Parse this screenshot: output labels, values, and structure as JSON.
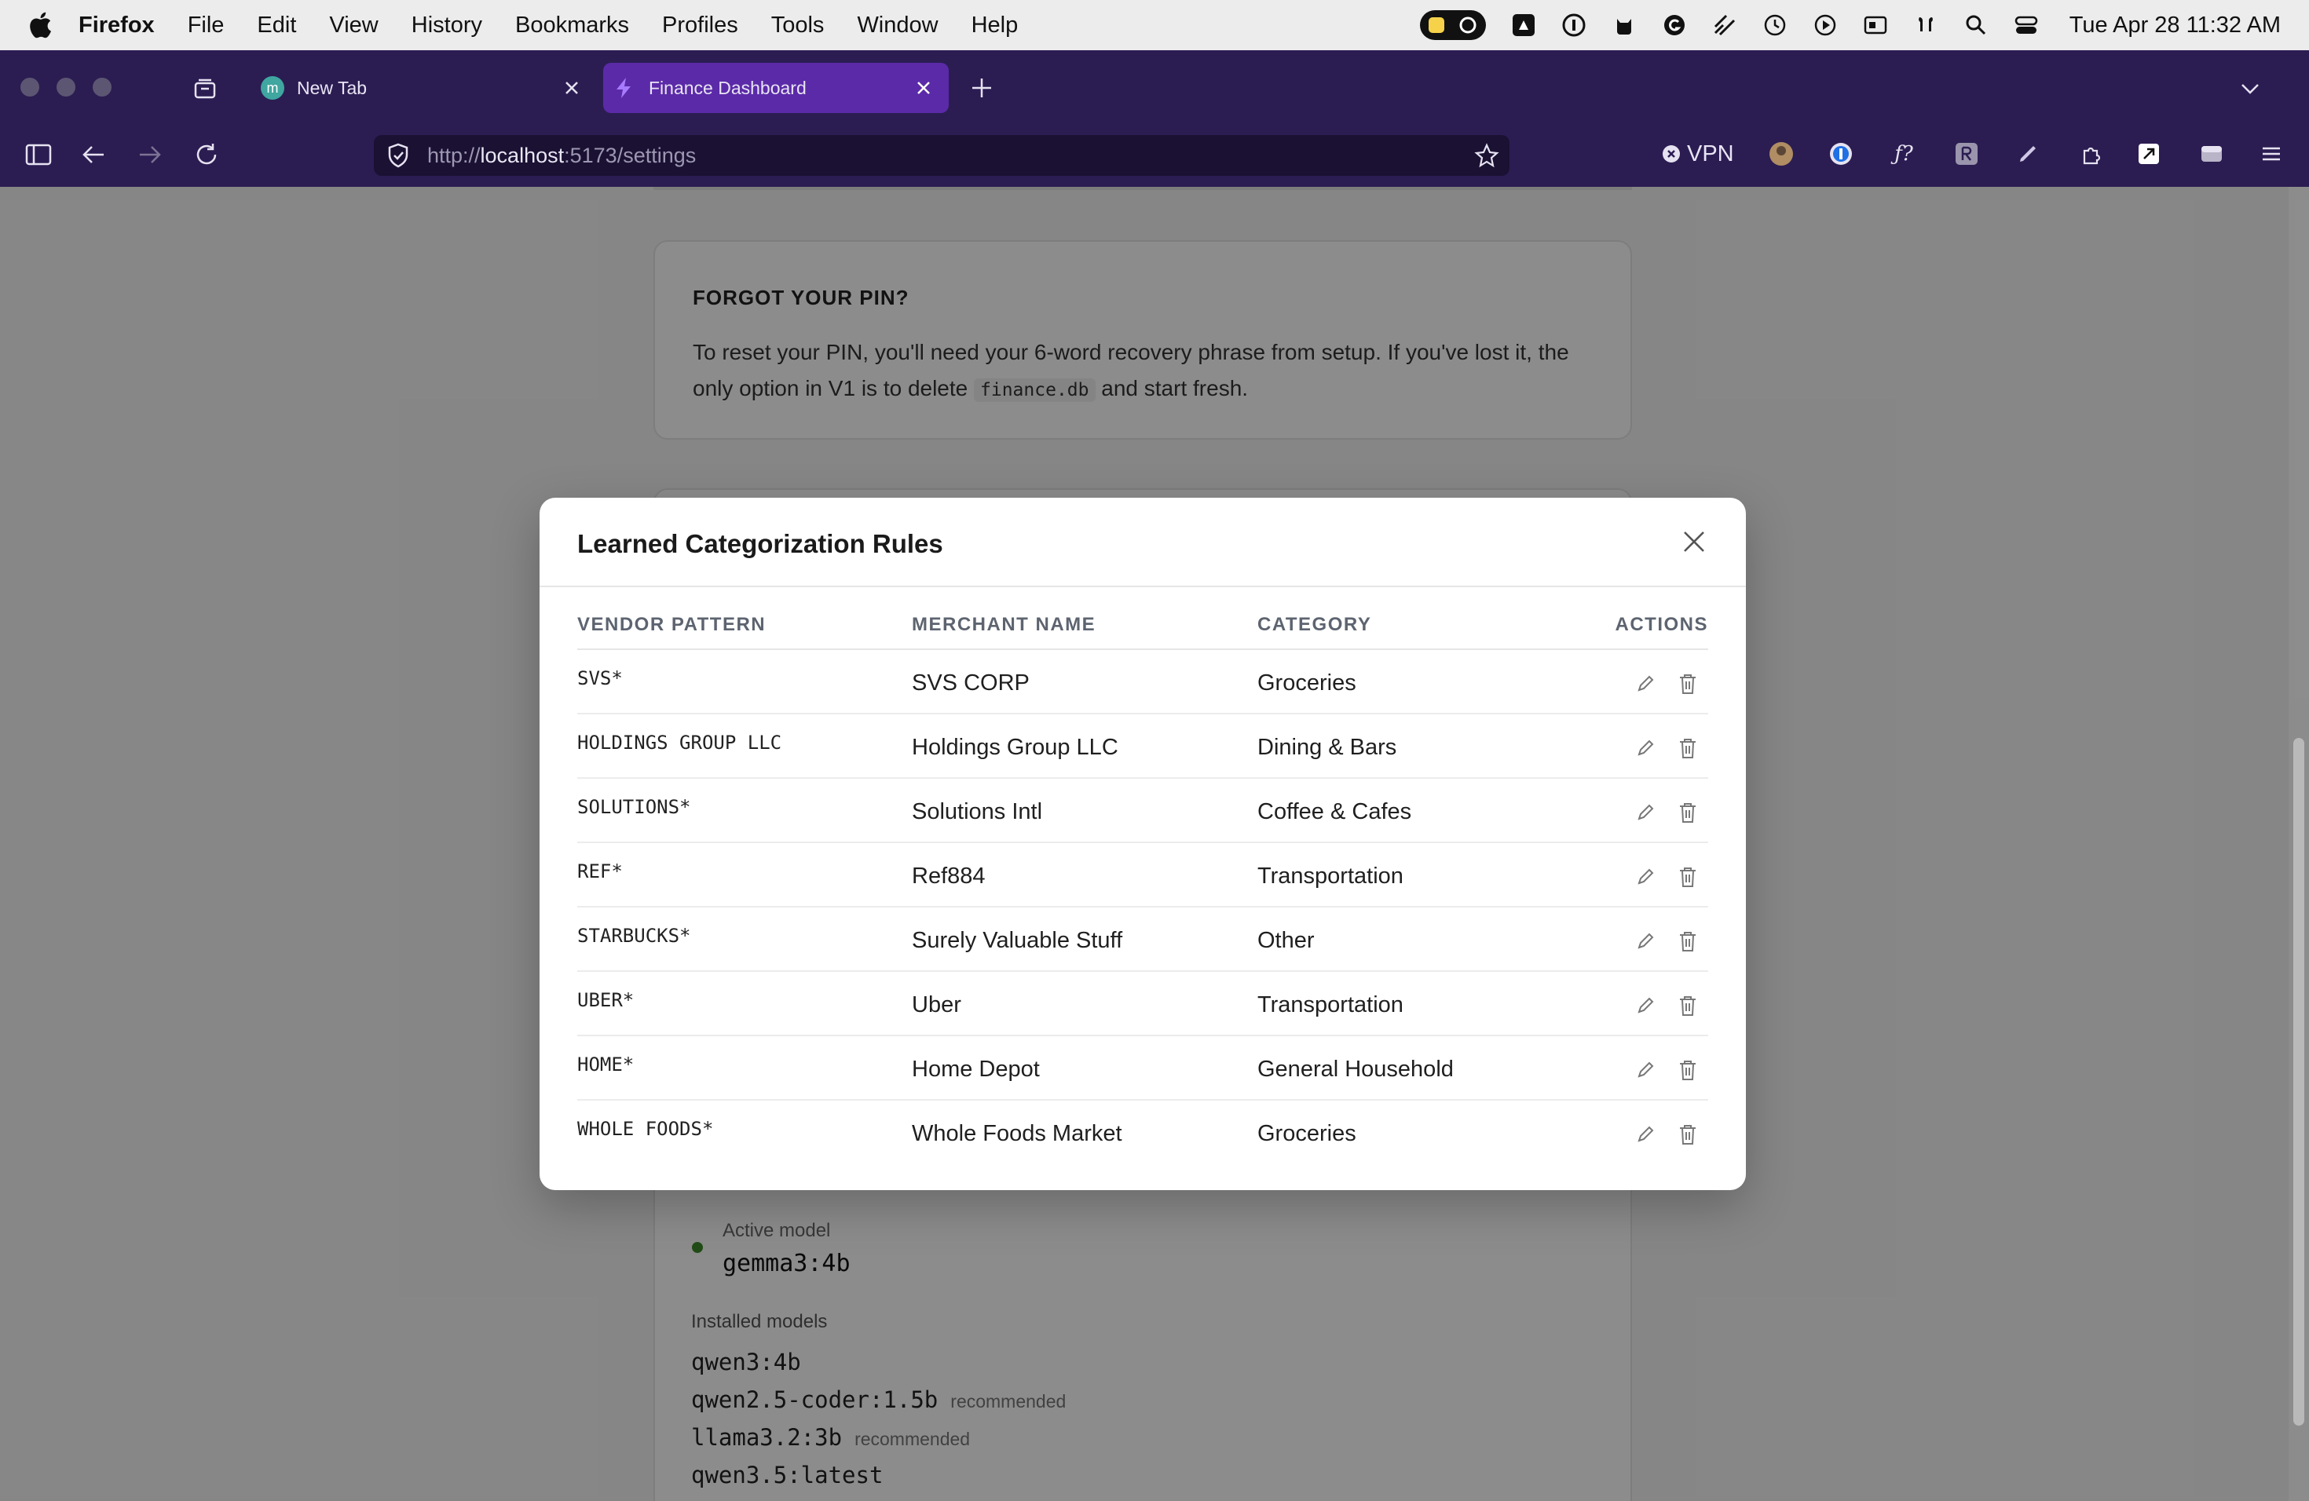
{
  "menubar": {
    "app": "Firefox",
    "items": [
      "File",
      "Edit",
      "View",
      "History",
      "Bookmarks",
      "Profiles",
      "Tools",
      "Window",
      "Help"
    ],
    "clock": "Tue Apr 28  11:32 AM"
  },
  "browser": {
    "tabs": [
      {
        "title": "New Tab",
        "favicon": "m"
      },
      {
        "title": "Finance Dashboard"
      }
    ],
    "url_scheme": "http://",
    "url_host": "localhost",
    "url_path": ":5173/settings",
    "vpn_label": "VPN",
    "colors": {
      "chrome": "#2b1d52",
      "active_tab": "#5b2aa8"
    }
  },
  "page": {
    "forgot_pin": {
      "heading": "FORGOT YOUR PIN?",
      "body_before": "To reset your PIN, you'll need your 6-word recovery phrase from setup. If you've lost it, the only option in V1 is to delete",
      "code": "finance.db",
      "body_after": "and start fresh."
    },
    "active_model_label": "Active model",
    "active_model": "gemma3:4b",
    "installed_label": "Installed models",
    "installed_models": [
      {
        "name": "qwen3:4b",
        "tag": ""
      },
      {
        "name": "qwen2.5-coder:1.5b",
        "tag": "recommended"
      },
      {
        "name": "llama3.2:3b",
        "tag": "recommended"
      },
      {
        "name": "qwen3.5:latest",
        "tag": ""
      }
    ]
  },
  "modal": {
    "title": "Learned Categorization Rules",
    "columns": [
      "VENDOR PATTERN",
      "MERCHANT NAME",
      "CATEGORY",
      "ACTIONS"
    ],
    "rules": [
      {
        "pattern": "SVS*",
        "merchant": "SVS CORP",
        "category": "Groceries"
      },
      {
        "pattern": "HOLDINGS GROUP LLC",
        "merchant": "Holdings Group LLC",
        "category": "Dining & Bars"
      },
      {
        "pattern": "SOLUTIONS*",
        "merchant": "Solutions Intl",
        "category": "Coffee & Cafes"
      },
      {
        "pattern": "REF*",
        "merchant": "Ref884",
        "category": "Transportation"
      },
      {
        "pattern": "STARBUCKS*",
        "merchant": "Surely Valuable Stuff",
        "category": "Other"
      },
      {
        "pattern": "UBER*",
        "merchant": "Uber",
        "category": "Transportation"
      },
      {
        "pattern": "HOME*",
        "merchant": "Home Depot",
        "category": "General Household"
      },
      {
        "pattern": "WHOLE FOODS*",
        "merchant": "Whole Foods Market",
        "category": "Groceries"
      }
    ]
  }
}
